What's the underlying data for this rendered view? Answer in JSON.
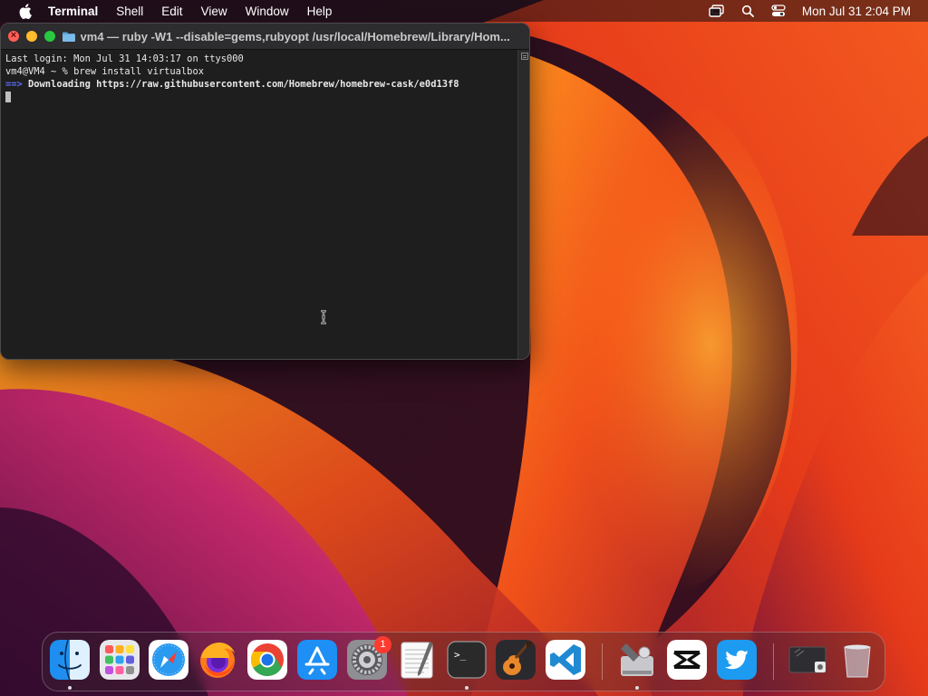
{
  "menubar": {
    "app_name": "Terminal",
    "items": [
      "Shell",
      "Edit",
      "View",
      "Window",
      "Help"
    ],
    "clock": "Mon Jul 31  2:04 PM"
  },
  "terminal": {
    "title": "vm4 — ruby -W1 --disable=gems,rubyopt /usr/local/Homebrew/Library/Hom...",
    "lines": {
      "login": "Last login: Mon Jul 31 14:03:17 on ttys000",
      "prompt": "vm4@VM4 ~ % brew install virtualbox",
      "arrow": "==>",
      "download": " Downloading https://raw.githubusercontent.com/Homebrew/homebrew-cask/e0d13f8"
    }
  },
  "dock": {
    "badge_count": "1",
    "apps": [
      "Finder",
      "Launchpad",
      "Safari",
      "Firefox",
      "Chrome",
      "App Store",
      "System Settings",
      "TextEdit",
      "Terminal",
      "GarageBand",
      "Visual Studio Code",
      "Disk Utility",
      "CapCut",
      "Twitter",
      "Screenshot",
      "Trash"
    ]
  },
  "colors": {
    "traffic_red": "#ff5f57",
    "traffic_yellow": "#febc2e",
    "traffic_green": "#28c840",
    "arrow_blue": "#5b6cf5"
  }
}
